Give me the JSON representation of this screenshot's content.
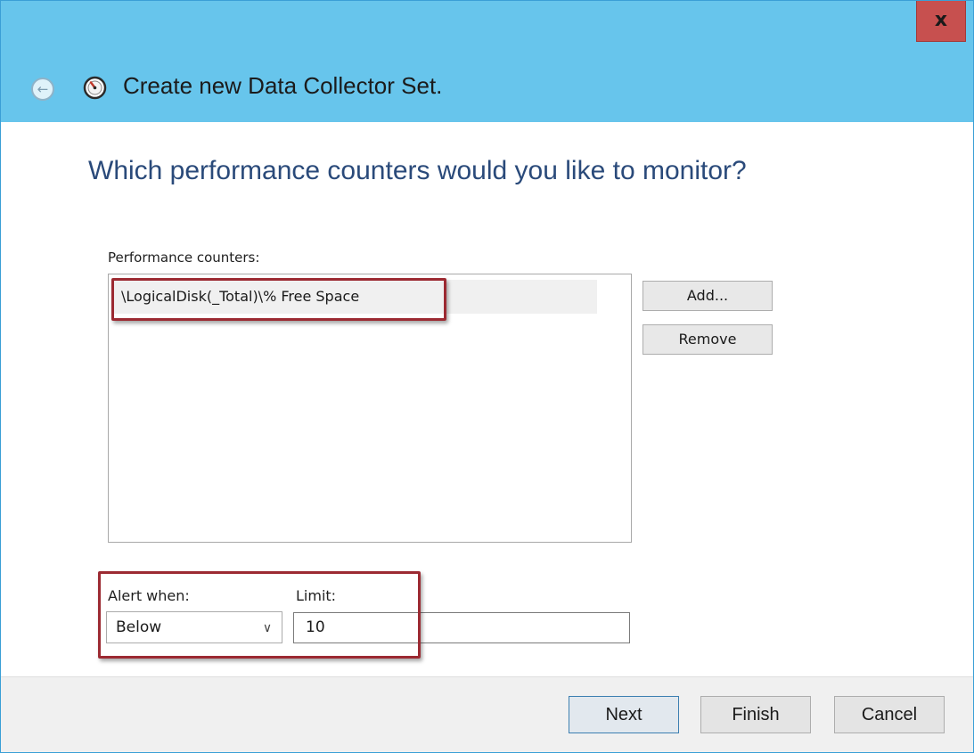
{
  "window": {
    "title": "Create new Data Collector Set.",
    "close_label": "x",
    "titlebar_color": "#67c5ec",
    "close_color": "#c7504f"
  },
  "icons": {
    "back": "back-arrow-icon",
    "app": "performance-monitor-icon"
  },
  "main": {
    "heading": "Which performance counters would you like to monitor?",
    "counters_label": "Performance counters:",
    "counters": [
      "\\LogicalDisk(_Total)\\% Free Space"
    ],
    "add_label": "Add...",
    "remove_label": "Remove",
    "alert_when_label": "Alert when:",
    "alert_when_value": "Below",
    "limit_label": "Limit:",
    "limit_value": "10",
    "highlight_color": "#9c2a32"
  },
  "footer": {
    "next_label": "Next",
    "finish_label": "Finish",
    "cancel_label": "Cancel"
  }
}
